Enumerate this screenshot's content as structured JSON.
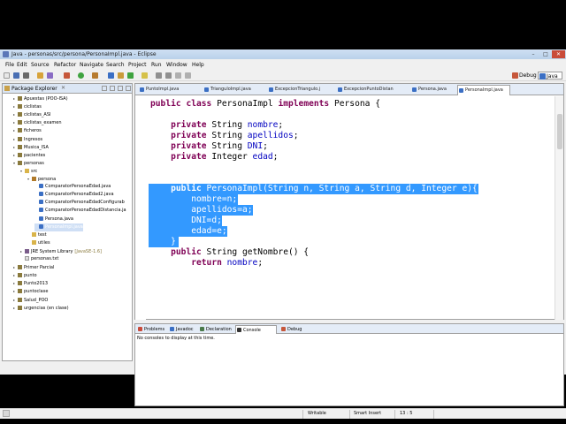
{
  "window": {
    "title": "Java - personas/src/persona/PersonaImpl.java - Eclipse",
    "minimize": "–",
    "maximize": "□",
    "close": "✕"
  },
  "menu": [
    "File",
    "Edit",
    "Source",
    "Refactor",
    "Navigate",
    "Search",
    "Project",
    "Run",
    "Window",
    "Help"
  ],
  "perspectives": [
    "Debug",
    "Java"
  ],
  "package_explorer": {
    "title": "Package Explorer",
    "tree": [
      {
        "label": "Apuestas (POO-ISA)",
        "type": "proj",
        "indent": 0,
        "twisty": "▸"
      },
      {
        "label": "ciclistas",
        "type": "proj",
        "indent": 0,
        "twisty": "▸"
      },
      {
        "label": "ciclistas_ASI",
        "type": "proj",
        "indent": 0,
        "twisty": "▸"
      },
      {
        "label": "ciclistas_examen",
        "type": "proj",
        "indent": 0,
        "twisty": "▸"
      },
      {
        "label": "ficheros",
        "type": "proj",
        "indent": 0,
        "twisty": "▸"
      },
      {
        "label": "Ingresos",
        "type": "proj",
        "indent": 0,
        "twisty": "▸"
      },
      {
        "label": "Musica_ISA",
        "type": "proj",
        "indent": 0,
        "twisty": "▸"
      },
      {
        "label": "pacientes",
        "type": "proj",
        "indent": 0,
        "twisty": "▸"
      },
      {
        "label": "personas",
        "type": "proj",
        "indent": 0,
        "twisty": "▾"
      },
      {
        "label": "src",
        "type": "folder",
        "indent": 1,
        "twisty": "▾"
      },
      {
        "label": "persona",
        "type": "pkg",
        "indent": 2,
        "twisty": "▾"
      },
      {
        "label": "ComparatorPersonaEdad.java",
        "type": "java",
        "indent": 3,
        "twisty": ""
      },
      {
        "label": "ComparatorPersonaEdad2.java",
        "type": "java",
        "indent": 3,
        "twisty": ""
      },
      {
        "label": "ComparatorPersonaEdadConfigurab",
        "type": "java",
        "indent": 3,
        "twisty": ""
      },
      {
        "label": "ComparatorPersonaEdadDistancia.ja",
        "type": "java",
        "indent": 3,
        "twisty": ""
      },
      {
        "label": "Persona.java",
        "type": "java",
        "indent": 3,
        "twisty": ""
      },
      {
        "label": "PersonaImpl.java",
        "type": "java",
        "indent": 3,
        "twisty": "",
        "selected": true
      },
      {
        "label": "test",
        "type": "folder",
        "indent": 2,
        "twisty": ""
      },
      {
        "label": "utiles",
        "type": "folder",
        "indent": 2,
        "twisty": ""
      },
      {
        "label": "JRE System Library",
        "suffix": "[JavaSE-1.6]",
        "type": "lib",
        "indent": 1,
        "twisty": "▸"
      },
      {
        "label": "personas.txt",
        "type": "file",
        "indent": 1,
        "twisty": ""
      },
      {
        "label": "Primer Parcial",
        "type": "proj",
        "indent": 0,
        "twisty": "▸"
      },
      {
        "label": "punto",
        "type": "proj",
        "indent": 0,
        "twisty": "▸"
      },
      {
        "label": "Punto2013",
        "type": "proj",
        "indent": 0,
        "twisty": "▸"
      },
      {
        "label": "puntoclase",
        "type": "proj",
        "indent": 0,
        "twisty": "▸"
      },
      {
        "label": "Salud_POO",
        "type": "proj",
        "indent": 0,
        "twisty": "▸"
      },
      {
        "label": "urgencias (en clase)",
        "type": "proj",
        "indent": 0,
        "twisty": "▸"
      }
    ]
  },
  "editor": {
    "tabs": [
      {
        "label": "PuntoImpl.java"
      },
      {
        "label": "TrianguloImpl.java"
      },
      {
        "label": "ExcepcionTriangulo.j"
      },
      {
        "label": "ExcepcionPuntoDistan"
      },
      {
        "label": "Persona.java"
      },
      {
        "label": "PersonaImpl.java",
        "active": true
      }
    ],
    "code": [
      {
        "text": "public class PersonaImpl implements Persona {",
        "selected": false
      },
      {
        "text": "",
        "selected": false
      },
      {
        "text": "    private String nombre;",
        "selected": false
      },
      {
        "text": "    private String apellidos;",
        "selected": false
      },
      {
        "text": "    private String DNI;",
        "selected": false
      },
      {
        "text": "    private Integer edad;",
        "selected": false
      },
      {
        "text": "",
        "selected": false
      },
      {
        "text": "",
        "selected": false
      },
      {
        "text": "    public PersonaImpl(String n, String a, String d, Integer e){",
        "selected": true
      },
      {
        "text": "        nombre=n;",
        "selected": true
      },
      {
        "text": "        apellidos=a;",
        "selected": true
      },
      {
        "text": "        DNI=d;",
        "selected": true
      },
      {
        "text": "        edad=e;",
        "selected": true
      },
      {
        "text": "    }",
        "selected": true
      },
      {
        "text": "    public String getNombre() {",
        "selected": false
      },
      {
        "text": "        return nombre;",
        "selected": false
      }
    ]
  },
  "console": {
    "tabs": [
      {
        "label": "Problems"
      },
      {
        "label": "Javadoc"
      },
      {
        "label": "Declaration"
      },
      {
        "label": "Console",
        "active": true
      },
      {
        "label": "Debug"
      }
    ],
    "message": "No consoles to display at this time."
  },
  "status": {
    "mode": "Writable",
    "insert": "Smart Insert",
    "position": "13 : 5"
  },
  "colors": {
    "keyword": "#7f0055",
    "field": "#0000c0",
    "selection": "#3399ff"
  }
}
